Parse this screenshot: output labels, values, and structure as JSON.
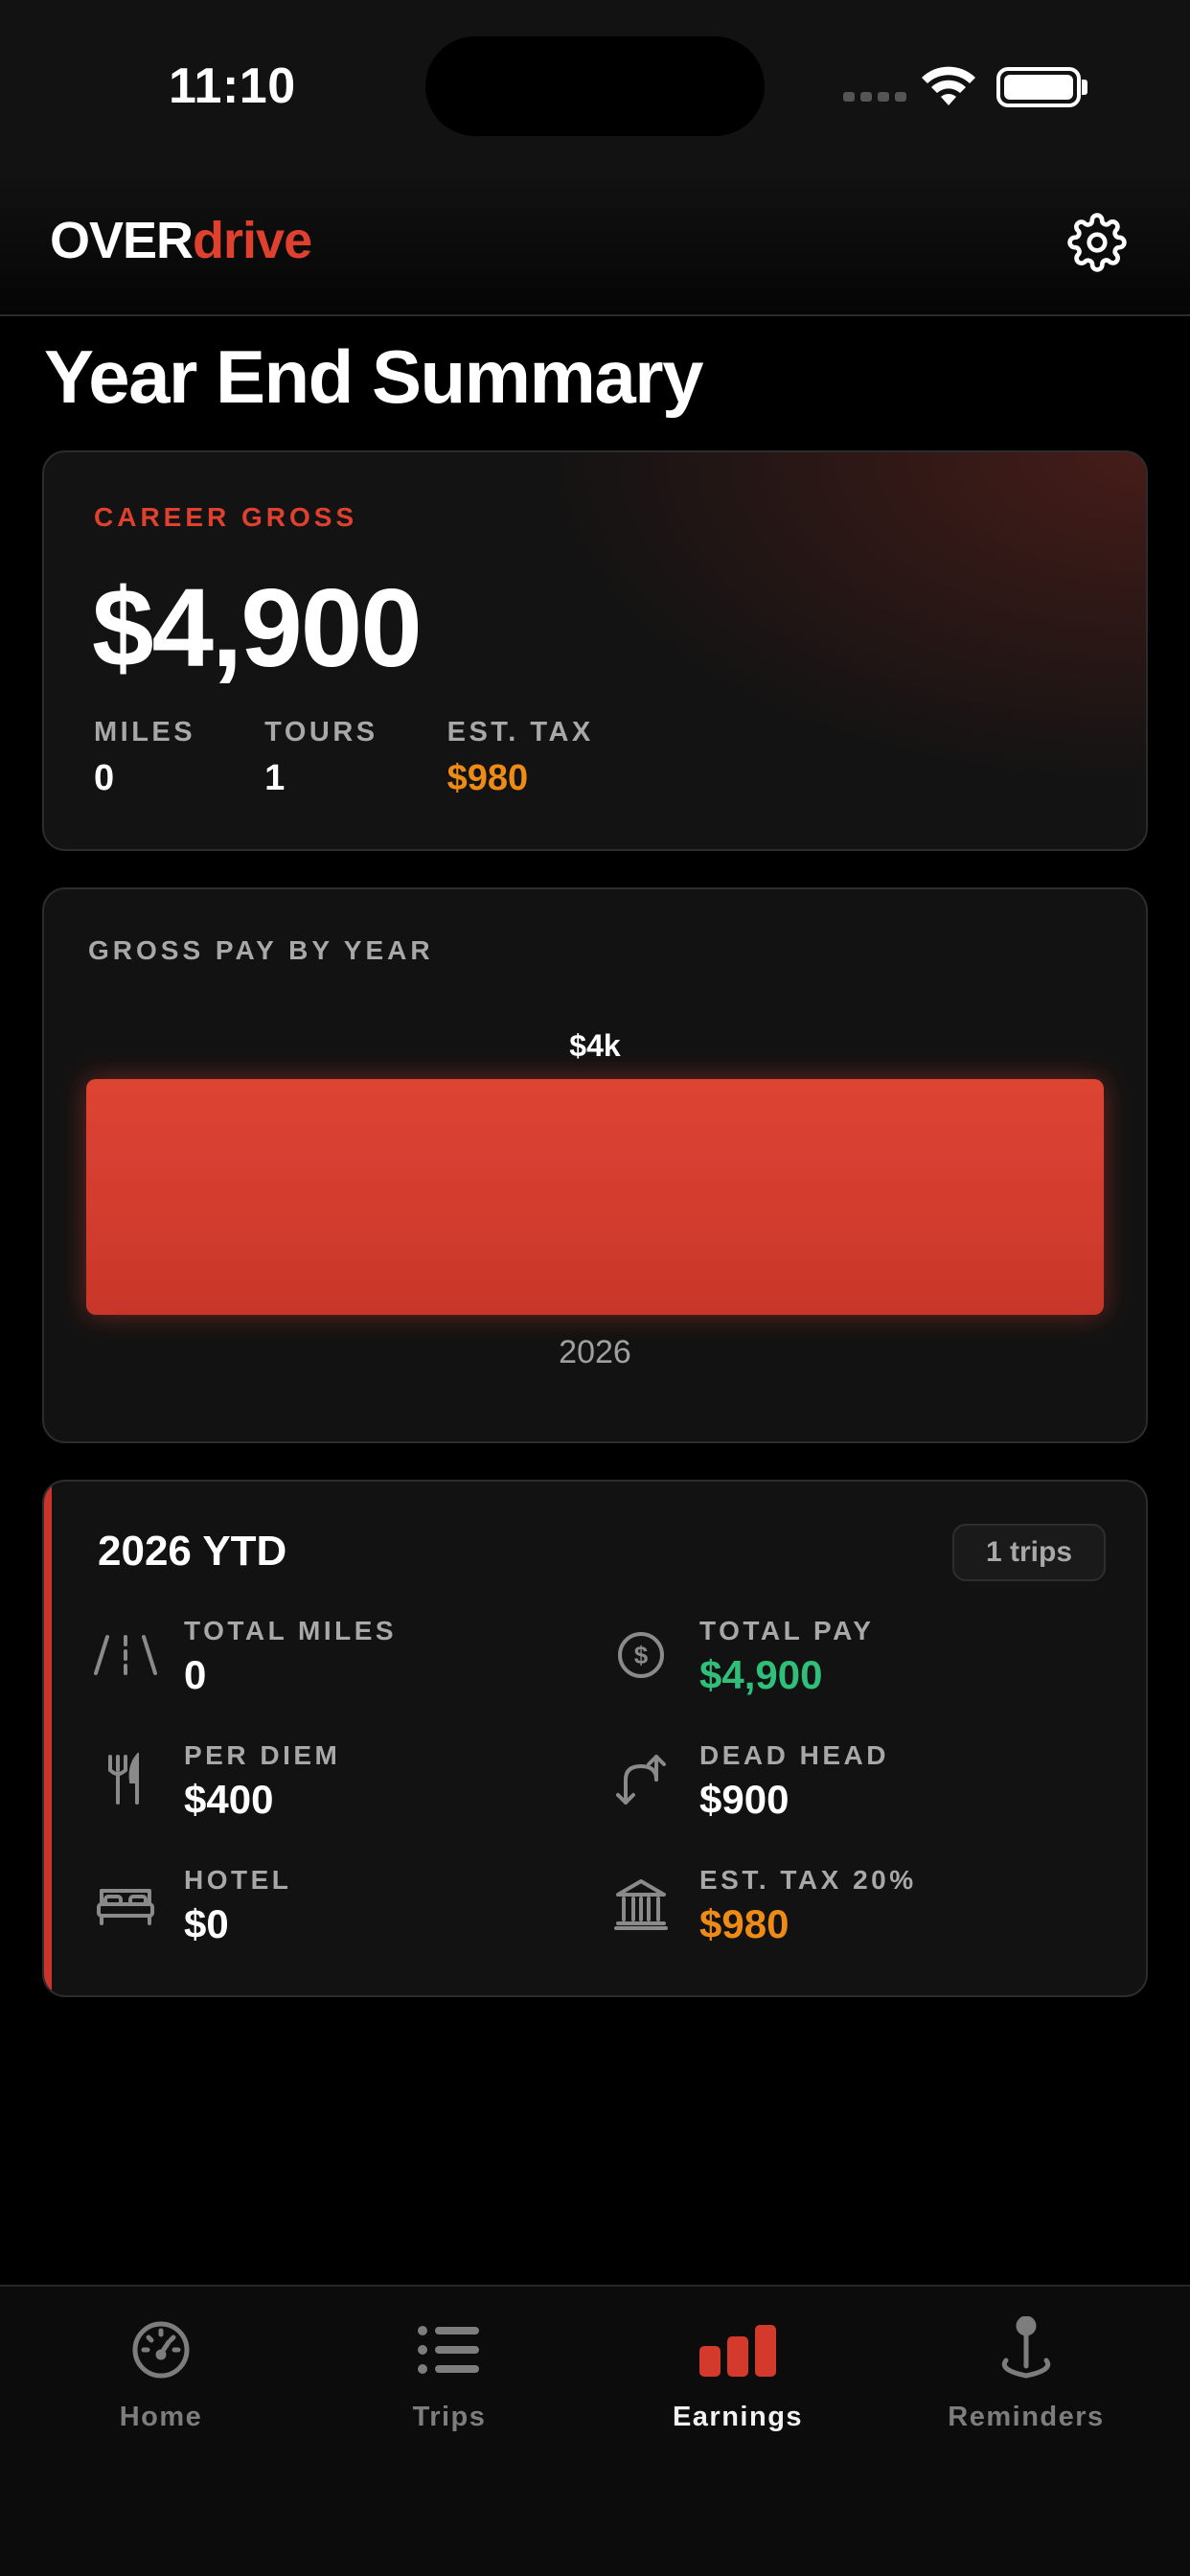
{
  "status_bar": {
    "time": "11:10"
  },
  "header": {
    "logo_over": "OVER",
    "logo_drive": "drive",
    "settings_icon": "gear-icon"
  },
  "page": {
    "title": "Year End Summary"
  },
  "career": {
    "label": "CAREER GROSS",
    "amount": "$4,900",
    "stats": [
      {
        "label": "MILES",
        "value": "0"
      },
      {
        "label": "TOURS",
        "value": "1"
      },
      {
        "label": "EST. TAX",
        "value": "$980"
      }
    ]
  },
  "gross_by_year": {
    "title": "GROSS PAY BY YEAR"
  },
  "chart_data": {
    "type": "bar",
    "title": "GROSS PAY BY YEAR",
    "categories": [
      "2026"
    ],
    "values": [
      4900
    ],
    "data_labels": [
      "$4k"
    ],
    "colors": {
      "bar": "#d8402f"
    },
    "grid": false,
    "legend": "none"
  },
  "ytd": {
    "title": "2026 YTD",
    "trips_badge": "1 trips",
    "metrics": [
      {
        "label": "TOTAL MILES",
        "value": "0",
        "icon": "road-icon"
      },
      {
        "label": "TOTAL PAY",
        "value": "$4,900",
        "icon": "dollar-coin-icon"
      },
      {
        "label": "PER DIEM",
        "value": "$400",
        "icon": "fork-knife-icon"
      },
      {
        "label": "DEAD HEAD",
        "value": "$900",
        "icon": "return-arrows-icon"
      },
      {
        "label": "HOTEL",
        "value": "$0",
        "icon": "bed-icon"
      },
      {
        "label": "EST. TAX 20%",
        "value": "$980",
        "icon": "bank-icon"
      }
    ]
  },
  "tabs": [
    {
      "label": "Home",
      "icon": "speedometer-icon"
    },
    {
      "label": "Trips",
      "icon": "list-icon"
    },
    {
      "label": "Earnings",
      "icon": "bar-chart-icon",
      "active": true
    },
    {
      "label": "Reminders",
      "icon": "map-pin-icon"
    }
  ],
  "colors": {
    "accent": "#e0412f",
    "positive": "#2fbf7a",
    "tax": "#ee8a16",
    "background": "#000000"
  }
}
